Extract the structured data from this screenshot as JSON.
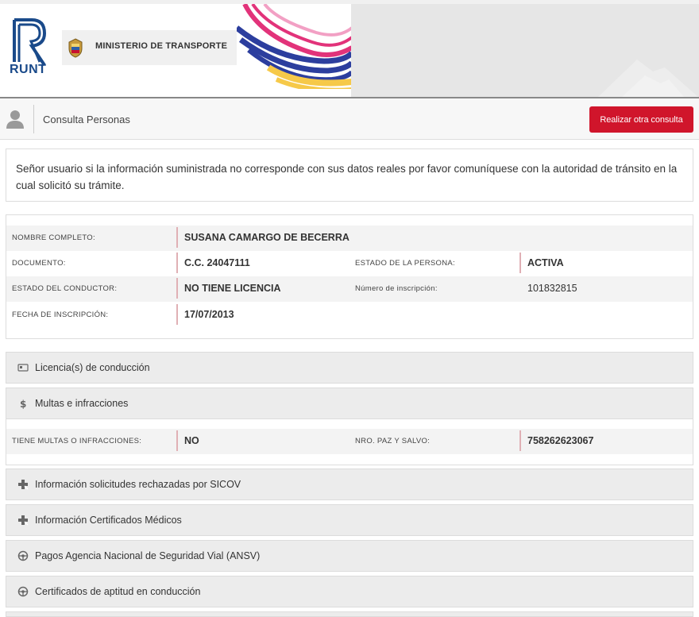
{
  "header": {
    "brand_logo": "RUNT",
    "ministerio_label": "MINISTERIO DE TRANSPORTE"
  },
  "subbar": {
    "title": "Consulta Personas",
    "action_button": "Realizar otra consulta"
  },
  "notice": {
    "text": "Señor usuario si la información suministrada no corresponde con sus datos reales por favor comuníquese con la autoridad de tránsito en la cual solicitó su trámite."
  },
  "person": {
    "nombre_label": "NOMBRE COMPLETO:",
    "nombre_value": "SUSANA CAMARGO DE BECERRA",
    "documento_label": "DOCUMENTO:",
    "documento_value": "C.C. 24047111",
    "estado_persona_label": "ESTADO DE LA PERSONA:",
    "estado_persona_value": "ACTIVA",
    "estado_conductor_label": "ESTADO DEL CONDUCTOR:",
    "estado_conductor_value": "NO TIENE LICENCIA",
    "numero_inscripcion_label": "Número de inscripción:",
    "numero_inscripcion_value": "101832815",
    "fecha_inscripcion_label": "FECHA DE INSCRIPCIÓN:",
    "fecha_inscripcion_value": "17/07/2013"
  },
  "sections": {
    "licencias": "Licencia(s) de conducción",
    "multas": "Multas e infracciones",
    "sicov": "Información solicitudes rechazadas por SICOV",
    "certificados_medicos": "Información Certificados Médicos",
    "ansv": "Pagos Agencia Nacional de Seguridad Vial (ANSV)",
    "aptitud": "Certificados de aptitud en conducción"
  },
  "multas": {
    "tiene_label": "TIENE MULTAS O INFRACCIONES:",
    "tiene_value": "NO",
    "paz_salvo_label": "NRO. PAZ Y SALVO:",
    "paz_salvo_value": "758262623067"
  },
  "colors": {
    "accent": "#d0152b",
    "brand_blue": "#1a4a8a"
  }
}
